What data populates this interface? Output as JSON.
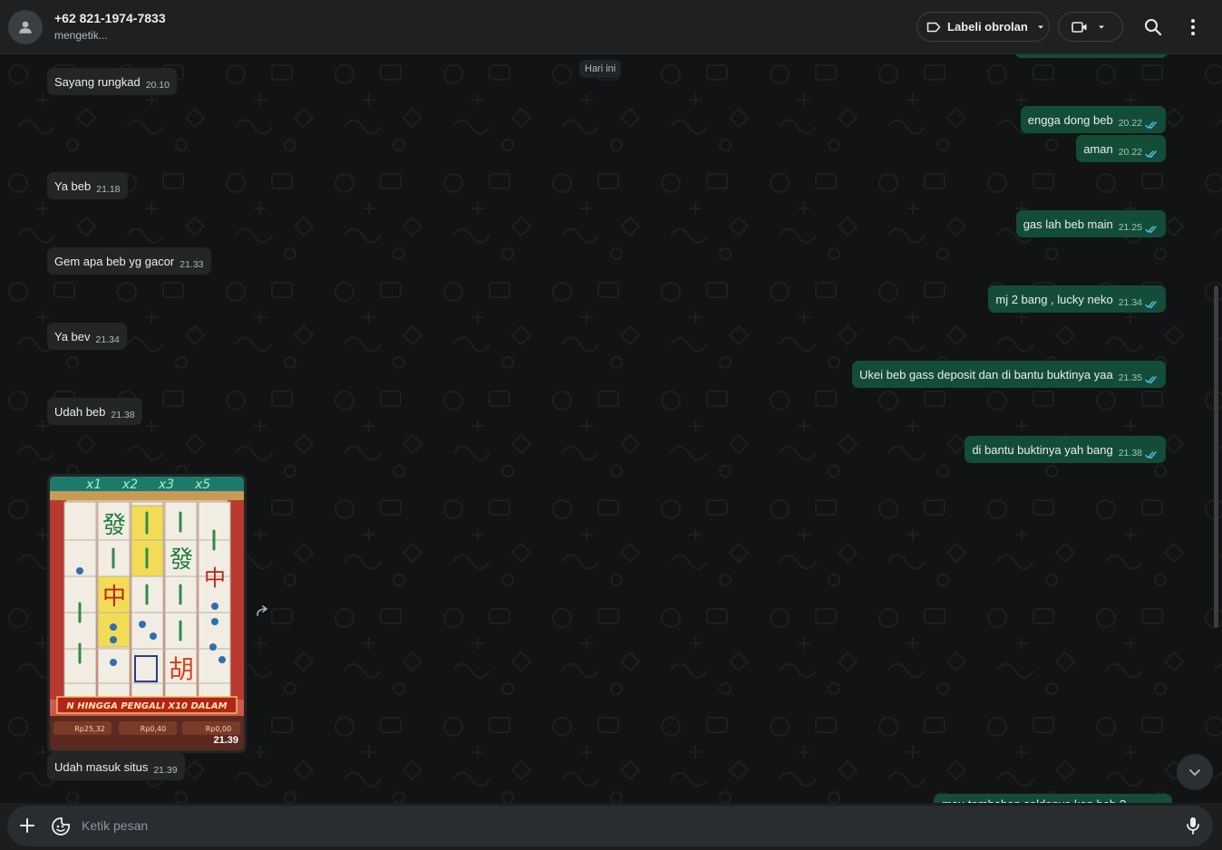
{
  "header": {
    "contact_name": "+62 821-1974-7833",
    "contact_status": "mengetik...",
    "label_button": "Labeli obrolan"
  },
  "chat": {
    "date_chip": "Hari ini",
    "incoming": [
      {
        "text": "Sayang rungkad",
        "time": "20.10"
      },
      {
        "text": "Ya beb",
        "time": "21.18"
      },
      {
        "text": "Gem apa beb yg gacor",
        "time": "21.33"
      },
      {
        "text": "Ya bev",
        "time": "21.34"
      },
      {
        "text": "Udah beb",
        "time": "21.38"
      }
    ],
    "outgoing": [
      {
        "text": "engga dong beb",
        "time": "20.22"
      },
      {
        "text": "aman",
        "time": "20.22"
      },
      {
        "text": "gas lah beb main",
        "time": "21.25"
      },
      {
        "text": "mj 2 bang , lucky neko",
        "time": "21.34"
      },
      {
        "text": "Ukei beb gass deposit dan di bantu buktinya yaa",
        "time": "21.35"
      },
      {
        "text": "di bantu buktinya yah bang",
        "time": "21.38"
      }
    ],
    "image_message": {
      "time": "21.39",
      "caption": "Udah masuk situs",
      "caption_time": "21.39",
      "game": {
        "multipliers": [
          "x1",
          "x2",
          "x3",
          "x5"
        ],
        "banner": "N HINGGA PENGALI X10 DALAM",
        "balances": [
          "Rp25,32",
          "Rp0,40",
          "Rp0,00"
        ]
      }
    },
    "partial_bottom_text": "mau tambahan saldonya kan beb ?"
  },
  "input": {
    "placeholder": "Ketik pesan"
  },
  "colors": {
    "incoming_bubble": "#242626",
    "outgoing_bubble": "#144d37",
    "tick_read": "#53bdeb"
  }
}
